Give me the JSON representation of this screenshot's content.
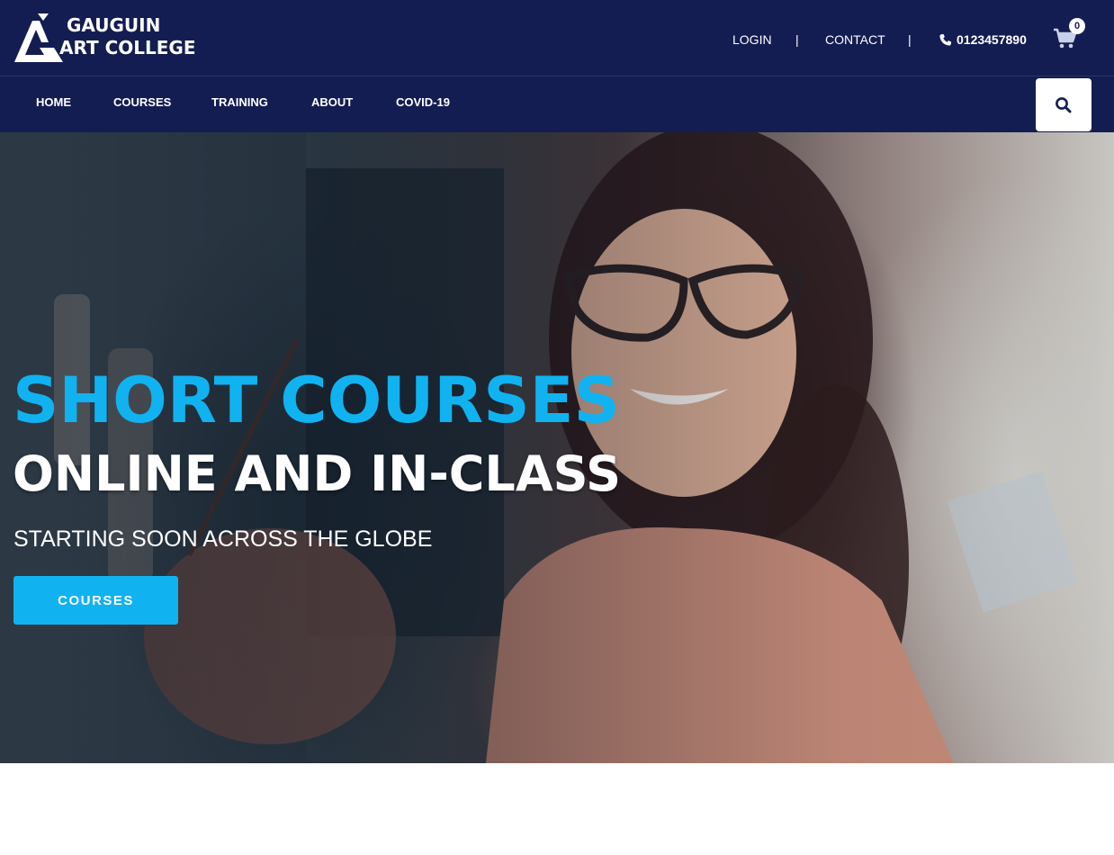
{
  "brand": {
    "line1": "GAUGUIN",
    "line2": "ART COLLEGE"
  },
  "topbar": {
    "login": "LOGIN",
    "separator": "|",
    "contact": "CONTACT",
    "phone": "0123457890",
    "cart_count": "0"
  },
  "nav": {
    "items": [
      "HOME",
      "COURSES",
      "TRAINING",
      "ABOUT",
      "COVID-19"
    ]
  },
  "hero": {
    "title1": "SHORT COURSES",
    "title2": "ONLINE AND IN-CLASS",
    "subtitle": "STARTING SOON ACROSS THE GLOBE",
    "button": "COURSES"
  },
  "icons": {
    "phone": "phone-icon",
    "cart": "cart-icon",
    "search": "search-icon",
    "logo": "logo-mark-icon"
  },
  "colors": {
    "header_bg": "#141d52",
    "accent": "#11b2f0",
    "text_light": "#ffffff"
  }
}
